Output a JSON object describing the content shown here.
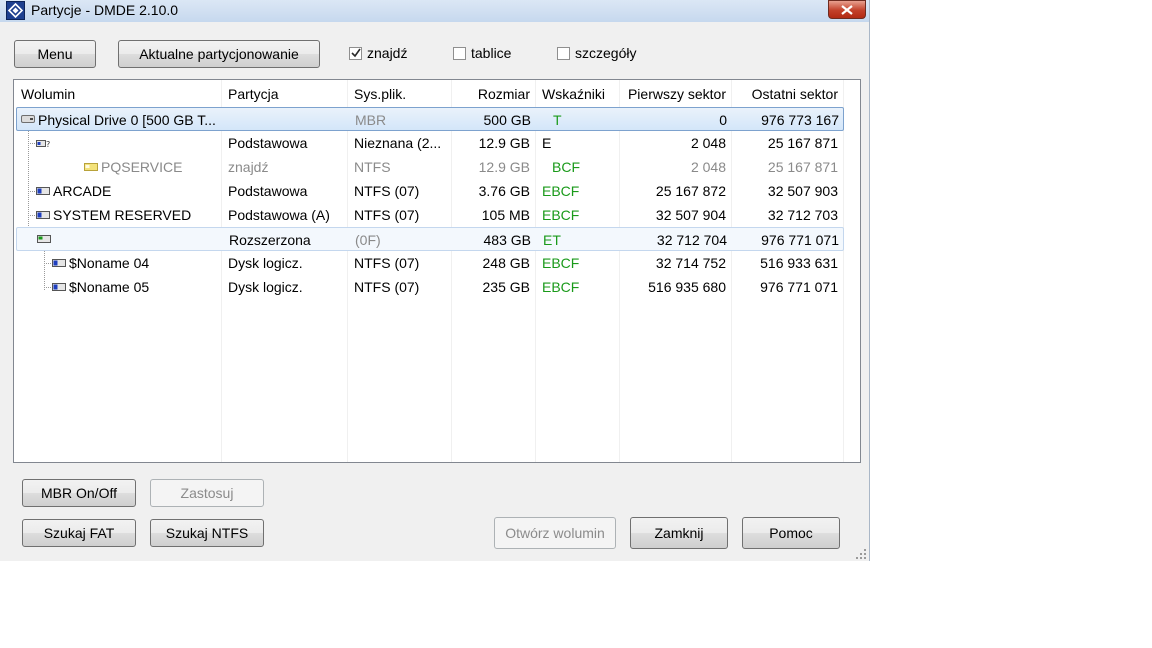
{
  "window": {
    "title": "Partycje - DMDE 2.10.0"
  },
  "toolbar": {
    "menu_label": "Menu",
    "current_partitioning_label": "Aktualne partycjonowanie",
    "checkboxes": [
      {
        "label": "znajdź",
        "checked": true
      },
      {
        "label": "tablice",
        "checked": false
      },
      {
        "label": "szczegóły",
        "checked": false
      }
    ]
  },
  "table": {
    "columns": [
      "Wolumin",
      "Partycja",
      "Sys.plik.",
      "Rozmiar",
      "Wskaźniki",
      "Pierwszy sektor",
      "Ostatni sektor"
    ],
    "rows": [
      {
        "volume": "Physical Drive 0 [500 GB T...",
        "partition": "",
        "fs": "MBR",
        "size": "500 GB",
        "flags": "T",
        "first": "0",
        "last": "976 773 167",
        "level": 0,
        "icon": "physical-drive-icon",
        "selected": true
      },
      {
        "volume": "",
        "partition": "Podstawowa",
        "fs": "Nieznana (2...",
        "size": "12.9 GB",
        "flags": "E",
        "first": "2 048",
        "last": "25 167 871",
        "level": 1,
        "icon": "unknown-partition-icon"
      },
      {
        "volume": "PQSERVICE",
        "partition": "znajdź",
        "fs": "NTFS",
        "size": "12.9 GB",
        "flags": "BCF",
        "first": "2 048",
        "last": "25 167 871",
        "level": 3,
        "icon": "found-volume-icon",
        "muted": true
      },
      {
        "volume": "ARCADE",
        "partition": "Podstawowa",
        "fs": "NTFS (07)",
        "size": "3.76 GB",
        "flags": "EBCF",
        "first": "25 167 872",
        "last": "32 507 903",
        "level": 1,
        "icon": "partition-icon"
      },
      {
        "volume": "SYSTEM RESERVED",
        "partition": "Podstawowa (A)",
        "fs": "NTFS (07)",
        "size": "105 MB",
        "flags": "EBCF",
        "first": "32 507 904",
        "last": "32 712 703",
        "level": 1,
        "icon": "partition-icon"
      },
      {
        "volume": "",
        "partition": "Rozszerzona",
        "fs": "(0F)",
        "size": "483 GB",
        "flags": "ET",
        "first": "32 712 704",
        "last": "976 771 071",
        "level": 1,
        "icon": "extended-partition-icon",
        "highlighted": true
      },
      {
        "volume": "$Noname 04",
        "partition": "Dysk logicz.",
        "fs": "NTFS (07)",
        "size": "248 GB",
        "flags": "EBCF",
        "first": "32 714 752",
        "last": "516 933 631",
        "level": 2,
        "icon": "partition-icon"
      },
      {
        "volume": "$Noname 05",
        "partition": "Dysk logicz.",
        "fs": "NTFS (07)",
        "size": "235 GB",
        "flags": "EBCF",
        "first": "516 935 680",
        "last": "976 771 071",
        "level": 2,
        "icon": "partition-icon"
      }
    ]
  },
  "buttons": {
    "mbr_onoff": "MBR On/Off",
    "apply": "Zastosuj",
    "search_fat": "Szukaj FAT",
    "search_ntfs": "Szukaj NTFS",
    "open_volume": "Otwórz wolumin",
    "close": "Zamknij",
    "help": "Pomoc"
  },
  "colors": {
    "flags_green": "#1a9a1a",
    "muted_grey": "#8a8a8a",
    "selection_border": "#7da2ce"
  }
}
